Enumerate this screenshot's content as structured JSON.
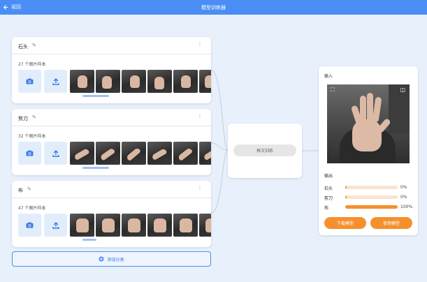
{
  "topbar": {
    "back_label": "返回",
    "title": "模型训练器"
  },
  "classes": [
    {
      "name": "石头",
      "count_label": "27 个图片样本",
      "progress": 0.3
    },
    {
      "name": "剪刀",
      "count_label": "32 个图片样本",
      "progress": 0.3
    },
    {
      "name": "布",
      "count_label": "47 个图片样本",
      "progress": 0.2
    }
  ],
  "add_class_label": "添加分类",
  "train": {
    "button_label": "再次训练"
  },
  "output": {
    "input_label": "输入",
    "output_label": "输出",
    "results": [
      {
        "name": "石头",
        "pct_label": "0%",
        "value": 0.02
      },
      {
        "name": "剪刀",
        "pct_label": "0%",
        "value": 0.02
      },
      {
        "name": "布",
        "pct_label": "100%",
        "value": 1.0
      }
    ],
    "download_label": "下载模型",
    "use_label": "使用模型"
  },
  "colors": {
    "accent": "#4a8ef5",
    "orange": "#f5902d",
    "background": "#e8f0fb"
  },
  "icons": [
    "back-arrow-icon",
    "pencil-icon",
    "more-vertical-icon",
    "camera-icon",
    "upload-icon",
    "plus-circle-icon",
    "crop-icon",
    "flip-camera-icon"
  ]
}
